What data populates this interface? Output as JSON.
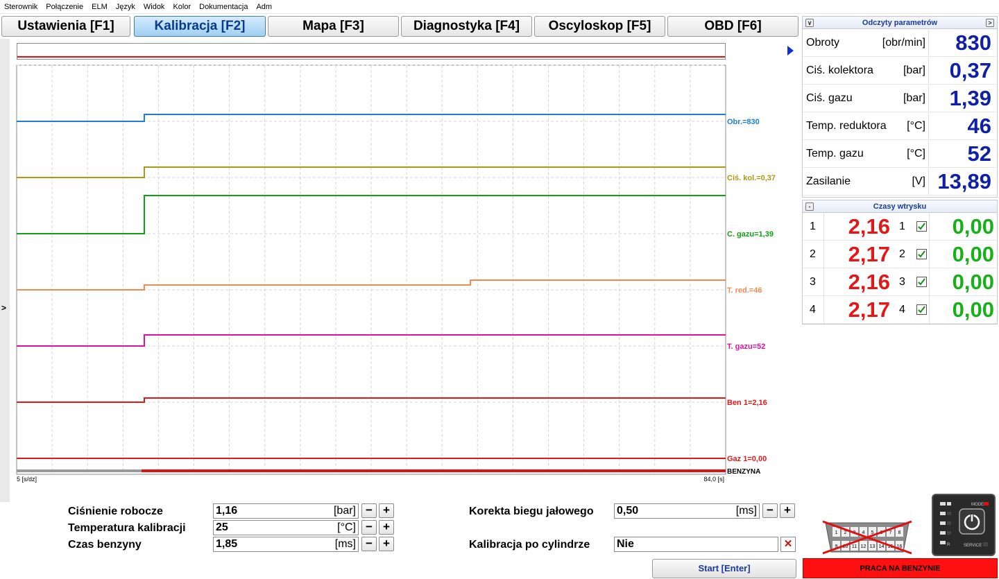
{
  "menu": [
    "Sterownik",
    "Połączenie",
    "ELM",
    "Język",
    "Widok",
    "Kolor",
    "Dokumentacja",
    "Adm"
  ],
  "tabs": [
    {
      "label": "Ustawienia [F1]",
      "active": false
    },
    {
      "label": "Kalibracja [F2]",
      "active": true
    },
    {
      "label": "Mapa [F3]",
      "active": false
    },
    {
      "label": "Diagnostyka [F4]",
      "active": false
    },
    {
      "label": "Oscyloskop [F5]",
      "active": false
    },
    {
      "label": "OBD [F6]",
      "active": false
    }
  ],
  "sidebar_toggle": ">",
  "chart_data": {
    "type": "line",
    "x_scale_label": "5 [s/dz]",
    "x_end_label": "84,0 [s]",
    "mode_label": "BENZYNA",
    "series": [
      {
        "name": "Obr.=830",
        "color": "#1a7fd4",
        "values": [
          {
            "t": 0,
            "v": 0.0
          },
          {
            "t": 0.18,
            "v": 0.0
          },
          {
            "t": 0.18,
            "v": 1.0
          },
          {
            "t": 1.0,
            "v": 1.0
          }
        ]
      },
      {
        "name": "Ciś. kol.=0,37",
        "color": "#a89a10",
        "values": [
          {
            "t": 0,
            "v": 0.0
          },
          {
            "t": 0.18,
            "v": 0.0
          },
          {
            "t": 0.18,
            "v": 1.0
          },
          {
            "t": 1.0,
            "v": 1.0
          }
        ]
      },
      {
        "name": "C. gazu=1,39",
        "color": "#10a010",
        "values": [
          {
            "t": 0,
            "v": 0.0
          },
          {
            "t": 0.18,
            "v": 0.0
          },
          {
            "t": 0.18,
            "v": 1.0
          },
          {
            "t": 1.0,
            "v": 1.0
          }
        ]
      },
      {
        "name": "T. red.=46",
        "color": "#f08a50",
        "values": [
          {
            "t": 0,
            "v": 0.0
          },
          {
            "t": 0.18,
            "v": 0.0
          },
          {
            "t": 0.18,
            "v": 0.5
          },
          {
            "t": 0.64,
            "v": 0.5
          },
          {
            "t": 0.64,
            "v": 1.0
          },
          {
            "t": 1.0,
            "v": 1.0
          }
        ]
      },
      {
        "name": "T. gazu=52",
        "color": "#e0109a",
        "values": [
          {
            "t": 0,
            "v": 0.0
          },
          {
            "t": 0.18,
            "v": 0.0
          },
          {
            "t": 0.18,
            "v": 1.0
          },
          {
            "t": 1.0,
            "v": 1.0
          }
        ]
      },
      {
        "name": "Ben 1=2,16",
        "color": "#e01818",
        "values": [
          {
            "t": 0,
            "v": 0.0
          },
          {
            "t": 0.18,
            "v": 0.0
          },
          {
            "t": 0.18,
            "v": 1.0
          },
          {
            "t": 1.0,
            "v": 1.0
          }
        ]
      },
      {
        "name": "Gaz 1=0,00",
        "color": "#e01818",
        "values": [
          {
            "t": 0,
            "v": 0.0
          },
          {
            "t": 1.0,
            "v": 0.0
          }
        ]
      }
    ]
  },
  "params": {
    "title": "Odczyty parametrów",
    "rows": [
      {
        "label": "Obroty",
        "unit": "[obr/min]",
        "value": "830"
      },
      {
        "label": "Ciś. kolektora",
        "unit": "[bar]",
        "value": "0,37"
      },
      {
        "label": "Ciś. gazu",
        "unit": "[bar]",
        "value": "1,39"
      },
      {
        "label": "Temp. reduktora",
        "unit": "[°C]",
        "value": "46"
      },
      {
        "label": "Temp. gazu",
        "unit": "[°C]",
        "value": "52"
      },
      {
        "label": "Zasilanie",
        "unit": "[V]",
        "value": "13,89"
      }
    ]
  },
  "injection": {
    "title": "Czasy wtrysku",
    "rows": [
      {
        "n": "1",
        "ben": "2,16",
        "n2": "1",
        "gaz": "0,00"
      },
      {
        "n": "2",
        "ben": "2,17",
        "n2": "2",
        "gaz": "0,00"
      },
      {
        "n": "3",
        "ben": "2,16",
        "n2": "3",
        "gaz": "0,00"
      },
      {
        "n": "4",
        "ben": "2,17",
        "n2": "4",
        "gaz": "0,00"
      }
    ]
  },
  "form": {
    "cisnienie_label": "Ciśnienie robocze",
    "cisnienie_value": "1,16",
    "cisnienie_unit": "[bar]",
    "temp_label": "Temperatura kalibracji",
    "temp_value": "25",
    "temp_unit": "[°C]",
    "czas_label": "Czas benzyny",
    "czas_value": "1,85",
    "czas_unit": "[ms]",
    "korekta_label": "Korekta biegu jałowego",
    "korekta_value": "0,50",
    "korekta_unit": "[ms]",
    "kalib_label": "Kalibracja po cylindrze",
    "kalib_value": "Nie",
    "minus": "−",
    "plus": "+",
    "x": "✕"
  },
  "start_label": "Start  [Enter]",
  "status_label": "PRACA NA BENZYNIE",
  "switch": {
    "mode_label": "MODE",
    "service_label": "SERVICE",
    "r_label": "R"
  },
  "obd_pins": [
    "1",
    "2",
    "3",
    "4",
    "5",
    "6",
    "7",
    "8",
    "9",
    "10",
    "11",
    "12",
    "13",
    "14",
    "15",
    "16"
  ]
}
